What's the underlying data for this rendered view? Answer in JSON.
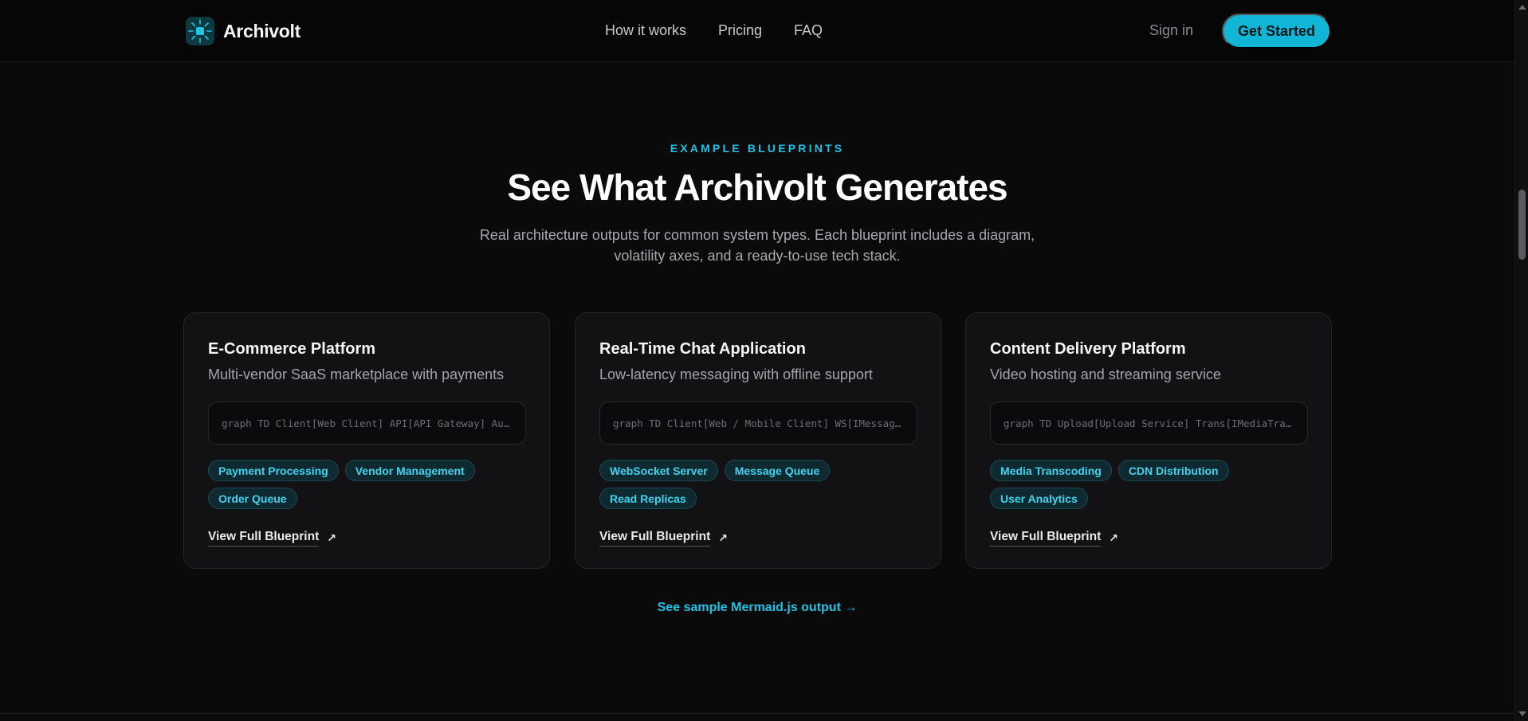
{
  "nav": {
    "brand": "Archivolt",
    "links": [
      "How it works",
      "Pricing",
      "FAQ"
    ],
    "sign_in": "Sign in",
    "cta": "Get Started"
  },
  "hero": {
    "eyebrow": "EXAMPLE BLUEPRINTS",
    "title": "See What Archivolt Generates",
    "subtitle": "Real architecture outputs for common system types. Each blueprint includes a diagram, volatility axes, and a ready-to-use tech stack."
  },
  "cards": [
    {
      "title": "E-Commerce Platform",
      "desc": "Multi-vendor SaaS marketplace with payments",
      "code": "graph TD Client[Web Client] API[API Gateway] Auth[Auth Service]",
      "tags": [
        "Payment Processing",
        "Vendor Management",
        "Order Queue"
      ],
      "link": "View Full Blueprint"
    },
    {
      "title": "Real-Time Chat Application",
      "desc": "Low-latency messaging with offline support",
      "code": "graph TD Client[Web / Mobile Client] WS[IMessageGateway]",
      "tags": [
        "WebSocket Server",
        "Message Queue",
        "Read Replicas"
      ],
      "link": "View Full Blueprint"
    },
    {
      "title": "Content Delivery Platform",
      "desc": "Video hosting and streaming service",
      "code": "graph TD Upload[Upload Service] Trans[IMediaTranscoder]",
      "tags": [
        "Media Transcoding",
        "CDN Distribution",
        "User Analytics"
      ],
      "link": "View Full Blueprint"
    }
  ],
  "sample_link": "See sample Mermaid.js output →",
  "colors": {
    "accent": "#11b6d6",
    "background": "#0a0a0b",
    "card": "#121215"
  }
}
